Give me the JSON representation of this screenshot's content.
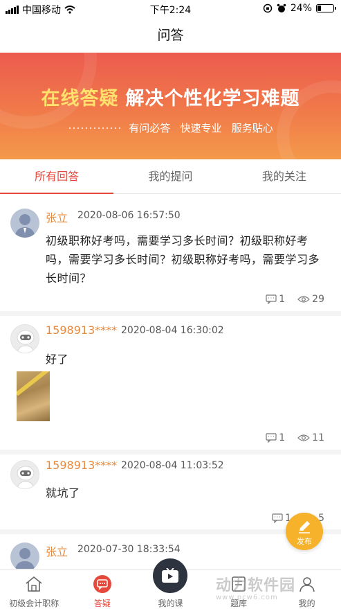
{
  "status_bar": {
    "carrier": "中国移动",
    "time": "下午2:24",
    "battery_percent": "24%",
    "battery_level": 0.24
  },
  "nav": {
    "title": "问答"
  },
  "banner": {
    "headline_yellow": "在线答疑",
    "headline_white": "解决个性化学习难题",
    "tagline": "有问必答   快速专业   服务贴心"
  },
  "tabs": [
    {
      "label": "所有回答",
      "active": true
    },
    {
      "label": "我的提问",
      "active": false
    },
    {
      "label": "我的关注",
      "active": false
    }
  ],
  "posts": [
    {
      "author": "张立",
      "time": "2020-08-06 16:57:50",
      "content": "初级职称好考吗，需要学习多长时间？初级职称好考吗，需要学习多长时间？初级职称好考吗，需要学习多长时间？",
      "comments": "1",
      "views": "29",
      "avatar": "person-avatar"
    },
    {
      "author": "1598913****",
      "time": "2020-08-04 16:30:02",
      "content": "好了",
      "comments": "1",
      "views": "11",
      "avatar": "robot-avatar",
      "has_image": true
    },
    {
      "author": "1598913****",
      "time": "2020-08-04 11:03:52",
      "content": "就坑了",
      "comments": "1",
      "views": "5",
      "avatar": "robot-avatar"
    },
    {
      "author": "张立",
      "time": "2020-07-30 18:33:54",
      "avatar": "person-avatar"
    }
  ],
  "publish_button": {
    "label": "发布"
  },
  "tabbar": [
    {
      "label": "初级会计职称",
      "icon": "home-icon",
      "active": false
    },
    {
      "label": "答疑",
      "icon": "chat-icon",
      "active": true
    },
    {
      "label": "我的课",
      "icon": "play-icon",
      "active": false
    },
    {
      "label": "题库",
      "icon": "book-icon",
      "active": false
    },
    {
      "label": "我的",
      "icon": "user-icon",
      "active": false
    }
  ],
  "watermark": {
    "text": "动力软件园",
    "sub": "www.pcw6.com"
  },
  "colors": {
    "accent": "#e4493c",
    "author": "#e88a3d",
    "publish": "#f5b22a",
    "banner_top": "#ec5b4e",
    "banner_bottom": "#f4994a"
  }
}
